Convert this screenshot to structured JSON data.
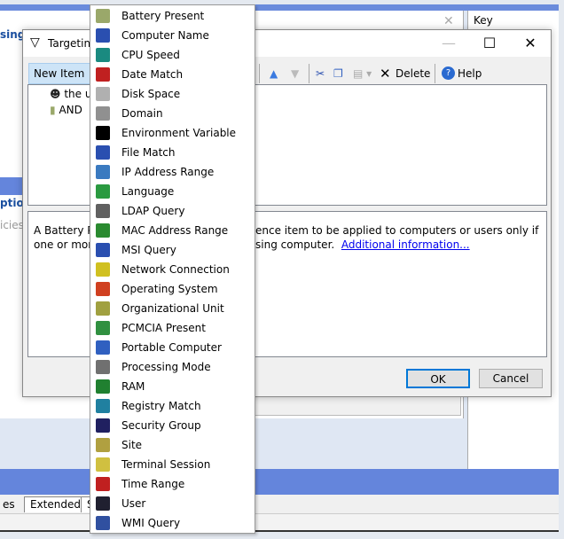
{
  "background": {
    "partial_texts": [
      "sing",
      "ptio",
      "icies"
    ],
    "key_label": "Key",
    "tabs": [
      "es",
      "Extended",
      "S"
    ]
  },
  "dialog": {
    "title": "Targeting",
    "minimize": "—",
    "maximize": "☐",
    "close": "✕",
    "toolbar": {
      "new_item": "New Item",
      "delete": "Delete",
      "help": "Help"
    },
    "tree": [
      {
        "icon": "user-icon",
        "text": "the u"
      },
      {
        "icon": "battery-icon",
        "text": "AND"
      }
    ],
    "description": {
      "text_left": "A Battery Pr",
      "text_right": "ence item to be applied to computers or users only if",
      "line2_left": "one or more",
      "line2_right": "sing computer.",
      "link": "Additional information..."
    },
    "ok": "OK",
    "cancel": "Cancel"
  },
  "menu": {
    "items": [
      {
        "label": "Battery Present",
        "icon": "battery-icon",
        "color": "#9aa86a"
      },
      {
        "label": "Computer Name",
        "icon": "computer-icon",
        "color": "#2a4fb0"
      },
      {
        "label": "CPU Speed",
        "icon": "cpu-mhz-icon",
        "color": "#1a8a80"
      },
      {
        "label": "Date Match",
        "icon": "calendar-icon",
        "color": "#c02020"
      },
      {
        "label": "Disk Space",
        "icon": "disk-icon",
        "color": "#b0b0b0"
      },
      {
        "label": "Domain",
        "icon": "domain-icon",
        "color": "#909090"
      },
      {
        "label": "Environment Variable",
        "icon": "env-variable-icon",
        "color": "#000000"
      },
      {
        "label": "File Match",
        "icon": "file-window-icon",
        "color": "#2a4fb0"
      },
      {
        "label": "IP Address Range",
        "icon": "network-computers-icon",
        "color": "#3a7ac0"
      },
      {
        "label": "Language",
        "icon": "globe-icon",
        "color": "#2a9a40"
      },
      {
        "label": "LDAP Query",
        "icon": "ldap-triangle-icon",
        "color": "#606060"
      },
      {
        "label": "MAC Address Range",
        "icon": "network-card-icon",
        "color": "#2a8a30"
      },
      {
        "label": "MSI Query",
        "icon": "msi-icon",
        "color": "#2a4fb0"
      },
      {
        "label": "Network Connection",
        "icon": "network-connection-icon",
        "color": "#d0c020"
      },
      {
        "label": "Operating System",
        "icon": "windows-icon",
        "color": "#d04020"
      },
      {
        "label": "Organizational Unit",
        "icon": "ou-folder-icon",
        "color": "#a0a040"
      },
      {
        "label": "PCMCIA Present",
        "icon": "pcmcia-icon",
        "color": "#309040"
      },
      {
        "label": "Portable Computer",
        "icon": "laptop-icon",
        "color": "#3060c0"
      },
      {
        "label": "Processing Mode",
        "icon": "script-icon",
        "color": "#707070"
      },
      {
        "label": "RAM",
        "icon": "ram-icon",
        "color": "#208030"
      },
      {
        "label": "Registry Match",
        "icon": "registry-icon",
        "color": "#2080a0"
      },
      {
        "label": "Security Group",
        "icon": "group-icon",
        "color": "#202060"
      },
      {
        "label": "Site",
        "icon": "site-icon",
        "color": "#b0a040"
      },
      {
        "label": "Terminal Session",
        "icon": "terminal-session-icon",
        "color": "#d0c040"
      },
      {
        "label": "Time Range",
        "icon": "clock-icon",
        "color": "#c02020"
      },
      {
        "label": "User",
        "icon": "user-icon",
        "color": "#202030"
      },
      {
        "label": "WMI Query",
        "icon": "wmi-icon",
        "color": "#3050a0"
      }
    ]
  }
}
